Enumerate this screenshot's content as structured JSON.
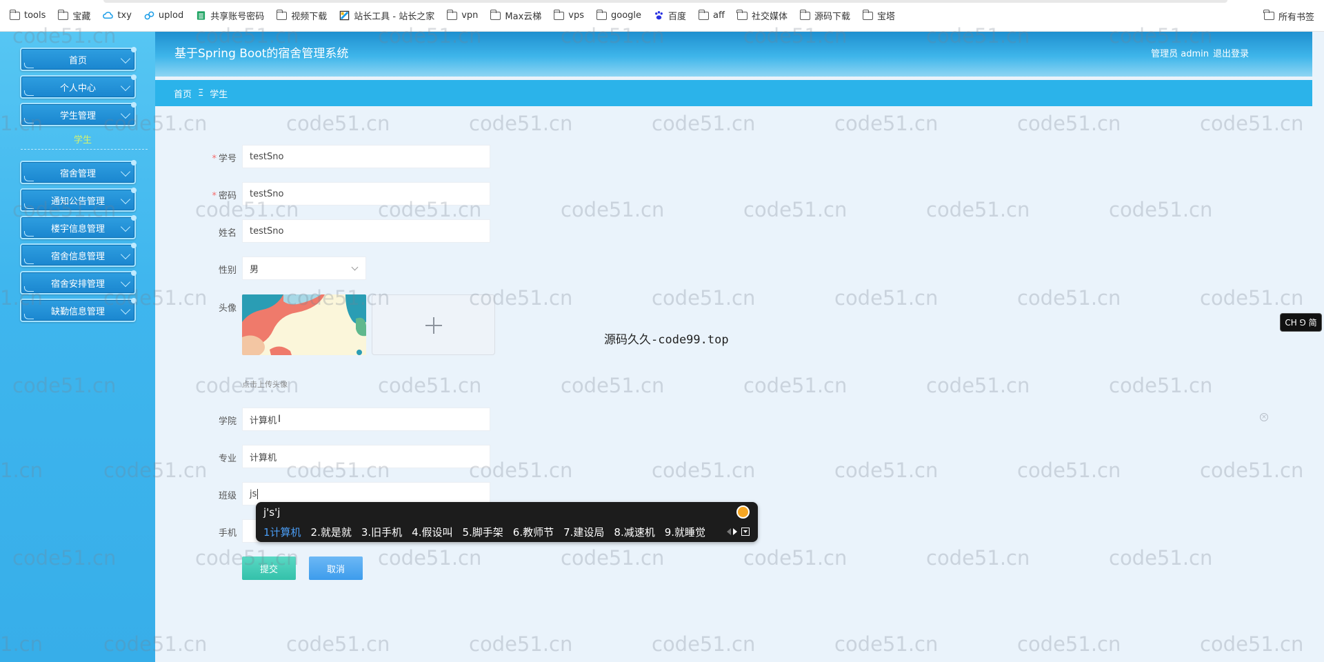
{
  "bookmarks": {
    "items": [
      {
        "label": "tools",
        "icon": "folder-icon"
      },
      {
        "label": "宝藏",
        "icon": "folder-icon"
      },
      {
        "label": "txy",
        "icon": "cloud-icon"
      },
      {
        "label": "uplod",
        "icon": "link-icon"
      },
      {
        "label": "共享账号密码",
        "icon": "sheet-icon"
      },
      {
        "label": "视频下载",
        "icon": "folder-icon"
      },
      {
        "label": "站长工具 - 站长之家",
        "icon": "site-icon"
      },
      {
        "label": "vpn",
        "icon": "folder-icon"
      },
      {
        "label": "Max云梯",
        "icon": "folder-icon"
      },
      {
        "label": "vps",
        "icon": "folder-icon"
      },
      {
        "label": "google",
        "icon": "folder-icon"
      },
      {
        "label": "百度",
        "icon": "paw-icon"
      },
      {
        "label": "aff",
        "icon": "folder-icon"
      },
      {
        "label": "社交媒体",
        "icon": "folder-icon"
      },
      {
        "label": "源码下载",
        "icon": "folder-icon"
      },
      {
        "label": "宝塔",
        "icon": "folder-icon"
      }
    ],
    "all_bookmarks": "所有书签"
  },
  "sidebar": {
    "items": [
      {
        "label": "首页"
      },
      {
        "label": "个人中心"
      },
      {
        "label": "学生管理"
      },
      {
        "label": "宿舍管理"
      },
      {
        "label": "通知公告管理"
      },
      {
        "label": "楼宇信息管理"
      },
      {
        "label": "宿舍信息管理"
      },
      {
        "label": "宿舍安排管理"
      },
      {
        "label": "缺勤信息管理"
      }
    ],
    "submenu": "学生"
  },
  "header": {
    "title": "基于Spring Boot的宿舍管理系统",
    "user": "管理员 admin",
    "logout": "退出登录"
  },
  "breadcrumb": {
    "home": "首页",
    "separator": "Ξ",
    "current": "学生"
  },
  "form": {
    "sno": {
      "label": "学号",
      "value": "testSno"
    },
    "password": {
      "label": "密码",
      "value": "testSno"
    },
    "name": {
      "label": "姓名",
      "value": "testSno"
    },
    "gender": {
      "label": "性别",
      "value": "男"
    },
    "avatar": {
      "label": "头像",
      "tip": "点击上传头像"
    },
    "college": {
      "label": "学院",
      "value": "计算机"
    },
    "major": {
      "label": "专业",
      "value": "计算机"
    },
    "class": {
      "label": "班级",
      "value": "js"
    },
    "phone": {
      "label": "手机",
      "value": ""
    },
    "submit": "提交",
    "cancel": "取消"
  },
  "center_note": "源码久久-code99.top",
  "ime": {
    "composition": "j's'j",
    "candidates": [
      "1计算机",
      "2.就是就",
      "3.旧手机",
      "4.假设叫",
      "5.脚手架",
      "6.教师节",
      "7.建设局",
      "8.减速机",
      "9.就睡觉"
    ]
  },
  "lang_badge": "CH ⅁ 简",
  "watermark": "code51.cn"
}
